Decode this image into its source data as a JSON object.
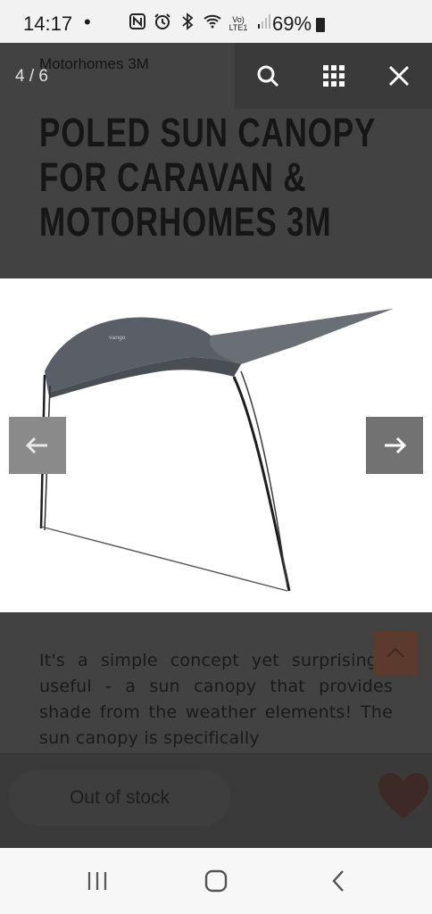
{
  "status_bar": {
    "time": "14:17",
    "dot": "•",
    "icons": [
      "nfc-icon",
      "alarm-icon",
      "bluetooth-icon",
      "wifi-calling-icon",
      "volte-icon",
      "signal-icon"
    ],
    "network": "Vo)\nLTE1",
    "battery_percent": "69%"
  },
  "lightbox": {
    "counter": "4 / 6",
    "buttons": [
      "search-icon",
      "grid-icon",
      "close-icon"
    ],
    "prev_arrow": "←",
    "next_arrow": "→",
    "image_alt": "Poled sun canopy for caravan & motorhomes 3M"
  },
  "product": {
    "title_small": "Motorhomes 3M",
    "title": "POLED SUN CANOPY FOR CARAVAN & MOTORHOMES 3M",
    "description": "It's a simple concept yet surprisingly useful - a sun canopy that provides shade from the weather elements! The sun canopy is specifically",
    "out_of_stock_label": "Out of stock"
  },
  "colors": {
    "overlay_bg": "#424242",
    "accent": "#5d3a2e",
    "toolbar_bg": "#3a3a3a",
    "canopy_fabric": "#5a5e66"
  }
}
